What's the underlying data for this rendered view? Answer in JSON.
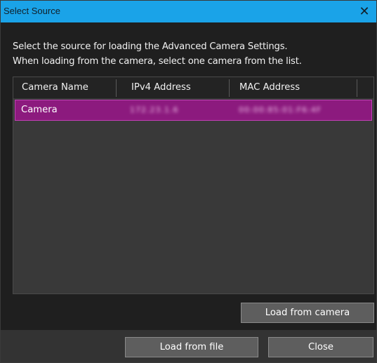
{
  "window": {
    "title": "Select Source",
    "close_glyph": "✕"
  },
  "instructions": {
    "line1": "Select the source for loading the Advanced Camera Settings.",
    "line2": "When loading from the camera, select one camera from the list."
  },
  "camera_list": {
    "columns": [
      "Camera Name",
      "IPv4 Address",
      "MAC Address"
    ],
    "rows": [
      {
        "name": "Camera",
        "ipv4": "172.23.1.6",
        "mac": "00:00:85:01:F6:4F",
        "selected": true
      }
    ]
  },
  "buttons": {
    "load_from_camera": "Load from camera",
    "load_from_file": "Load from file",
    "close": "Close"
  },
  "colors": {
    "titlebar": "#1aa3e8",
    "selection": "#8c1a7e",
    "selection_border": "#c040b4",
    "button": "#5e5e5e"
  },
  "icons": {
    "close": "close-icon"
  }
}
